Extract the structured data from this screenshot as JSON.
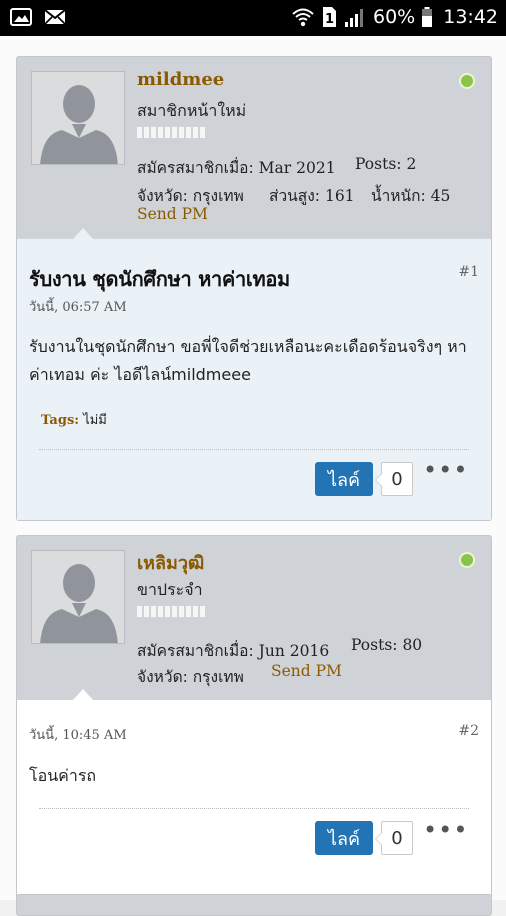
{
  "status_bar": {
    "battery": "60%",
    "time": "13:42",
    "sim": "1",
    "icons": [
      "image-icon",
      "mail-icon",
      "wifi-icon",
      "sim-icon",
      "signal-icon",
      "battery-icon"
    ]
  },
  "colors": {
    "username": "#8a5a00",
    "like_button": "#2374b4",
    "online": "#8bc34a"
  },
  "posts": [
    {
      "username": "mildmee",
      "user_title": "สมาชิกหน้าใหม่",
      "joined_label": "สมัครสมาชิกเมื่อ:",
      "joined_value": "Mar 2021",
      "posts_label": "Posts:",
      "posts_value": "2",
      "province_label": "จังหวัด:",
      "province_value": "กรุงเทพ",
      "height_label": "ส่วนสูง:",
      "height_value": "161",
      "weight_label": "น้ำหนัก:",
      "weight_value": "45",
      "send_pm": "Send PM",
      "title": "รับงาน ชุดนักศึกษา หาค่าเทอม",
      "date": "วันนี้, 06:57 AM",
      "number": "#1",
      "body": "รับงานในชุดนักศึกษา ขอพี่ใจดีช่วยเหลือนะคะเดือดร้อนจริงๆ หาค่าเทอม ค่ะ ไอดีไลน์mildmeee",
      "tags_label": "Tags:",
      "tags_value": "ไม่มี",
      "like_label": "ไลค์",
      "like_count": "0",
      "more": "•••"
    },
    {
      "username": "เหลิมวุฒิ",
      "user_title": "ขาประจำ",
      "joined_label": "สมัครสมาชิกเมื่อ:",
      "joined_value": "Jun 2016",
      "posts_label": "Posts:",
      "posts_value": "80",
      "province_label": "จังหวัด:",
      "province_value": "กรุงเทพ",
      "send_pm": "Send PM",
      "date": "วันนี้, 10:45 AM",
      "number": "#2",
      "body": "โอนค่ารถ",
      "like_label": "ไลค์",
      "like_count": "0",
      "more": "•••"
    }
  ]
}
